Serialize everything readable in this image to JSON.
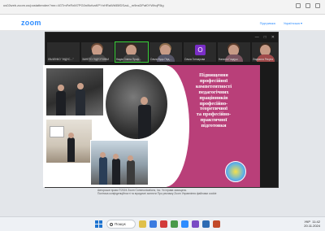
{
  "browser": {
    "url": "us02web.zoom.us/postattendee?mn=4GTmFeRxM7PG0ni9ofvaKPYnHRaWb55fDSzuL_m9nsDPaf0YWhqP5ig"
  },
  "zoom_header": {
    "logo": "zoom",
    "links": [
      "Підтримка",
      "Українська ▾"
    ]
  },
  "meeting": {
    "controls": [
      "—",
      "□",
      "✕"
    ],
    "participants": [
      {
        "name": "ІЛЬЧЕНКО \"ІНДУС…\"",
        "type": "text"
      },
      {
        "name": "ЗАНЕТО ПІДГОТОВКА",
        "type": "face"
      },
      {
        "name": "Надія Олена Проф…",
        "type": "face"
      },
      {
        "name": "Ольга Куць Пед…",
        "type": "face"
      },
      {
        "name": "Ольга Гончарова",
        "type": "letter",
        "letter": "O"
      },
      {
        "name": "Наталія Гладуш",
        "type": "face"
      },
      {
        "name": "Людмила Рекуна",
        "type": "face"
      }
    ]
  },
  "slide": {
    "title_lines": [
      "Підвищення",
      "професійної",
      "компетентності",
      "педагогічних",
      "працівників",
      "професійно-",
      "теоретичної",
      "та професійно-",
      "практичної",
      "підготовки"
    ]
  },
  "footer": {
    "lines": [
      "Авторське право ©2024 Zoom Communications, Inc. Усі права захищено.",
      "Політика конфіденційності та юридичні аспекти   Про рекламу Zoom   Управління файлами cookie"
    ]
  },
  "taskbar": {
    "search_label": "Пошук",
    "time": "11:42",
    "date": "20.11.2024",
    "lang": "УКР"
  },
  "colors": {
    "zoom_blue": "#2d8cff",
    "slide_pink": "#b93f79"
  }
}
